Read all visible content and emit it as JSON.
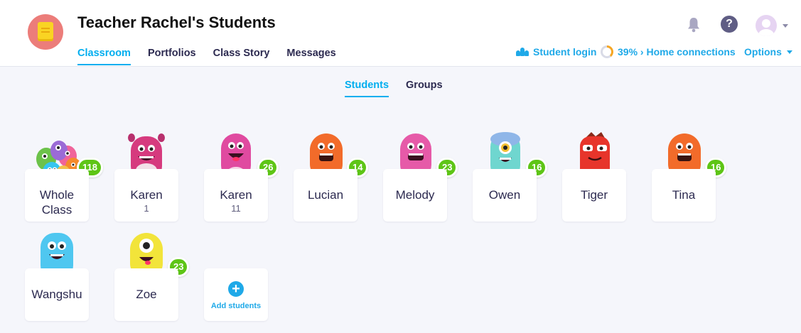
{
  "header": {
    "title": "Teacher Rachel's Students",
    "tabs": [
      {
        "label": "Classroom",
        "active": true
      },
      {
        "label": "Portfolios"
      },
      {
        "label": "Class Story"
      },
      {
        "label": "Messages"
      }
    ],
    "student_login": "Student login",
    "home_connections": "39% › Home connections",
    "home_connections_percent": 39,
    "options": "Options",
    "help_glyph": "?",
    "accent_color": "#00aeef"
  },
  "subtabs": [
    {
      "label": "Students",
      "active": true
    },
    {
      "label": "Groups"
    }
  ],
  "students": [
    {
      "name": "Whole Class",
      "name_line1": "Whole",
      "name_line2": "Class",
      "points": 118,
      "avatar": "group-monsters-icon"
    },
    {
      "name": "Karen",
      "sub": "1",
      "avatar": "pink-monster-icon"
    },
    {
      "name": "Karen",
      "sub": "11",
      "points": 26,
      "avatar": "magenta-monster-icon"
    },
    {
      "name": "Lucian",
      "points": 14,
      "avatar": "orange-monster-icon"
    },
    {
      "name": "Melody",
      "points": 23,
      "avatar": "pink-monster-icon"
    },
    {
      "name": "Owen",
      "points": 16,
      "avatar": "teal-cyclops-monster-icon"
    },
    {
      "name": "Tiger",
      "avatar": "red-monster-icon"
    },
    {
      "name": "Tina",
      "points": 16,
      "avatar": "orange-monster-icon"
    },
    {
      "name": "Wangshu",
      "avatar": "blue-monster-icon"
    },
    {
      "name": "Zoe",
      "points": 23,
      "avatar": "yellow-cyclops-monster-icon"
    }
  ],
  "add_students": {
    "label": "Add students",
    "glyph": "+"
  },
  "colors": {
    "points_badge": "#5ec516",
    "link": "#1fa9e8"
  }
}
